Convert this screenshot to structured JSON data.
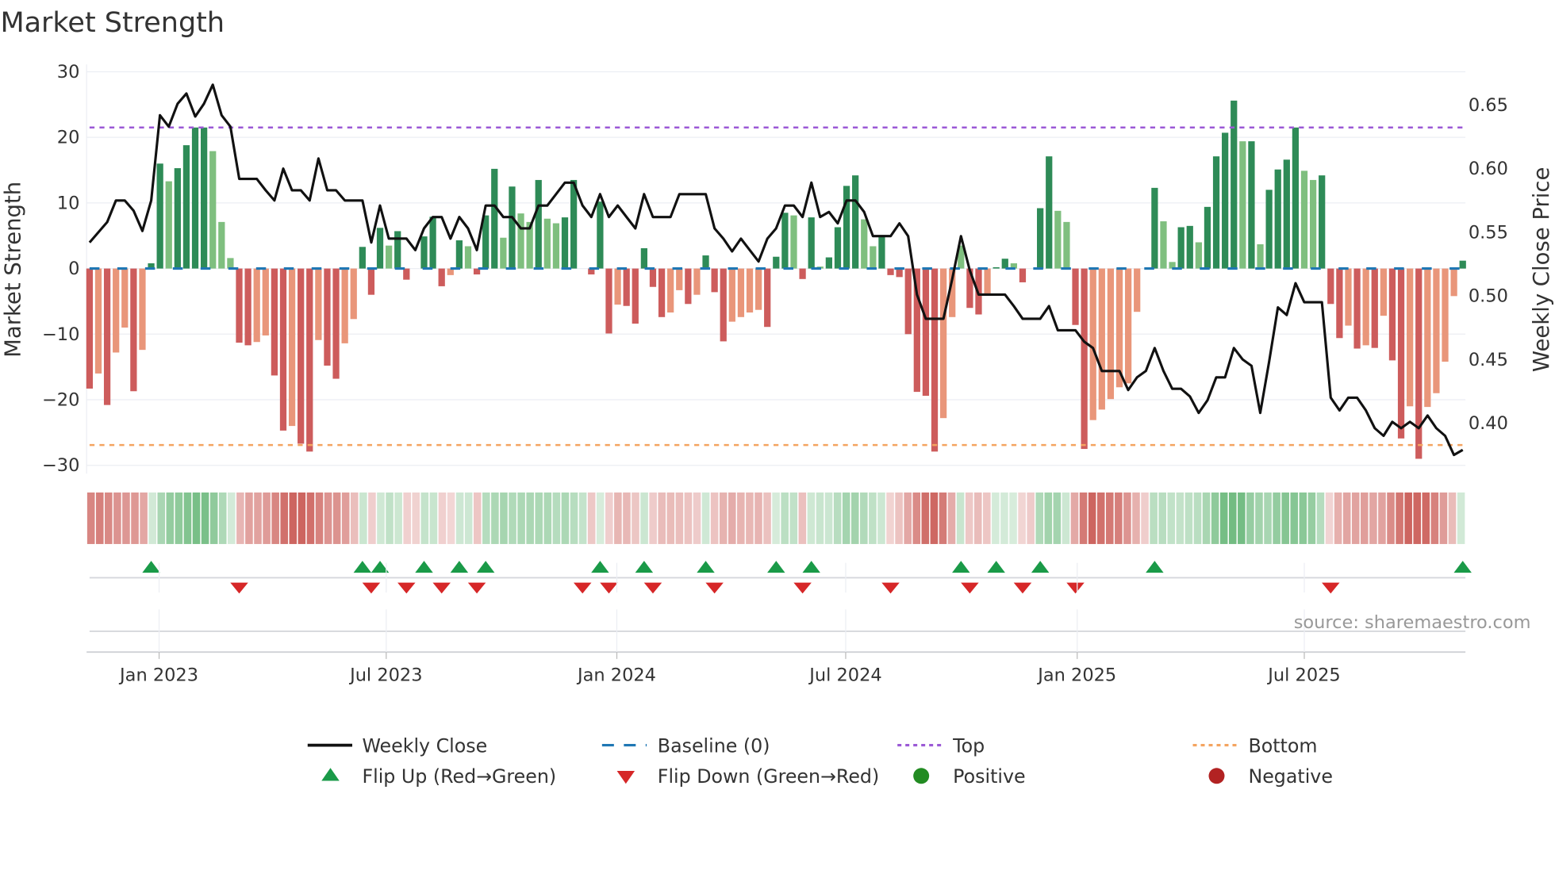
{
  "title": "Market Strength",
  "source": "source: sharemaestro.com",
  "chart_data": {
    "type": "bar",
    "title": "Market Strength",
    "ylabel": "Market Strength",
    "y2label": "Weekly Close Price",
    "ylim": [
      -30,
      30
    ],
    "y2lim": [
      0.37,
      0.665
    ],
    "yticks": [
      "30",
      "20",
      "10",
      "0",
      "−10",
      "−20",
      "−30"
    ],
    "ytick_values": [
      30,
      20,
      10,
      0,
      -10,
      -20,
      -30
    ],
    "y2ticks": [
      "0.65",
      "0.60",
      "0.55",
      "0.50",
      "0.45",
      "0.40"
    ],
    "y2tick_values": [
      0.65,
      0.6,
      0.55,
      0.5,
      0.45,
      0.4
    ],
    "xticks": [
      {
        "label": "Jan 2023",
        "week": 7.9
      },
      {
        "label": "Jul 2023",
        "week": 33.7
      },
      {
        "label": "Jan 2024",
        "week": 59.9
      },
      {
        "label": "Jul 2024",
        "week": 85.9
      },
      {
        "label": "Jan 2025",
        "week": 112.2
      },
      {
        "label": "Jul 2025",
        "week": 138.0
      }
    ],
    "top_level": 21.5,
    "bottom_level": -26.9,
    "baseline": 0,
    "strength": [
      -18.3,
      -16,
      -20.8,
      -12.8,
      -9,
      -18.7,
      -12.4,
      0.8,
      16,
      13.3,
      15.3,
      18.8,
      21.5,
      21.5,
      17.9,
      7.1,
      1.6,
      -11.3,
      -11.7,
      -11.2,
      -10.2,
      -16.3,
      -24.7,
      -24,
      -26.7,
      -27.9,
      -10.9,
      -14.8,
      -16.8,
      -11.4,
      -7.7,
      3.3,
      -4,
      6.2,
      3.5,
      5.7,
      -1.7,
      0,
      4.9,
      7.9,
      -2.7,
      -1,
      4.3,
      3.4,
      -0.9,
      8.1,
      15.2,
      4.7,
      12.5,
      8.4,
      7.1,
      13.5,
      7.6,
      6.9,
      7.8,
      13.5,
      0,
      -0.9,
      10.2,
      -9.9,
      -5.5,
      -5.7,
      -8.4,
      3.1,
      -2.8,
      -7.4,
      -6.7,
      -3.3,
      -5.4,
      -4,
      2,
      -3.6,
      -11.1,
      -8.1,
      -7.4,
      -6.7,
      -6.3,
      -8.9,
      1.8,
      8.5,
      8.1,
      -1.6,
      7.8,
      0.3,
      1.7,
      6.3,
      12.6,
      14.2,
      7.5,
      3.4,
      4.9,
      -1,
      -1.3,
      -10,
      -18.8,
      -19.4,
      -27.9,
      -22.8,
      -7.4,
      3.5,
      -6,
      -7,
      -3.8,
      0.2,
      1.5,
      0.8,
      -2.1,
      0,
      9.2,
      17.1,
      8.8,
      7.1,
      -8.6,
      -27.5,
      -23.1,
      -21.5,
      -19.9,
      -18.1,
      -17.5,
      -6.6,
      0,
      12.3,
      7.2,
      1,
      6.3,
      6.5,
      4,
      9.4,
      17.1,
      20.7,
      25.6,
      19.4,
      19.4,
      3.7,
      12,
      15.1,
      16.6,
      21.5,
      14.9,
      13.5,
      14.2,
      -5.4,
      -10.6,
      -8.7,
      -12.2,
      -11.7,
      -12.1,
      -7.2,
      -14,
      -25.9,
      -21,
      -29,
      -21.1,
      -19,
      -14.2,
      -4.2,
      1.2
    ],
    "strong": [
      1,
      0,
      1,
      0,
      0,
      1,
      0,
      1,
      1,
      0,
      1,
      1,
      1,
      1,
      0,
      0,
      0,
      1,
      1,
      0,
      0,
      1,
      1,
      0,
      1,
      1,
      0,
      1,
      1,
      0,
      0,
      1,
      1,
      1,
      0,
      1,
      1,
      1,
      1,
      1,
      1,
      0,
      1,
      0,
      1,
      1,
      1,
      0,
      1,
      0,
      0,
      1,
      0,
      0,
      1,
      1,
      1,
      1,
      1,
      1,
      0,
      1,
      1,
      1,
      1,
      1,
      0,
      0,
      1,
      0,
      1,
      1,
      1,
      0,
      0,
      0,
      0,
      1,
      1,
      1,
      0,
      1,
      1,
      0,
      1,
      1,
      1,
      1,
      0,
      0,
      1,
      1,
      1,
      1,
      1,
      1,
      1,
      0,
      0,
      0,
      1,
      1,
      0,
      1,
      1,
      0,
      1,
      1,
      1,
      1,
      0,
      0,
      1,
      1,
      0,
      0,
      0,
      0,
      0,
      0,
      1,
      1,
      0,
      0,
      1,
      1,
      0,
      1,
      1,
      1,
      1,
      0,
      1,
      0,
      1,
      1,
      1,
      1,
      0,
      0,
      1,
      1,
      1,
      0,
      1,
      0,
      1,
      0,
      1,
      1,
      0,
      1,
      0,
      0,
      0,
      0,
      1
    ],
    "weekly_close": [
      0.542,
      0.55,
      0.558,
      0.575,
      0.575,
      0.567,
      0.551,
      0.575,
      0.642,
      0.633,
      0.651,
      0.659,
      0.641,
      0.651,
      0.666,
      0.642,
      0.633,
      0.592,
      0.592,
      0.592,
      0.583,
      0.575,
      0.6,
      0.583,
      0.583,
      0.575,
      0.608,
      0.583,
      0.583,
      0.575,
      0.575,
      0.575,
      0.542,
      0.571,
      0.545,
      0.545,
      0.545,
      0.536,
      0.553,
      0.562,
      0.562,
      0.545,
      0.562,
      0.553,
      0.536,
      0.571,
      0.571,
      0.562,
      0.562,
      0.553,
      0.553,
      0.571,
      0.571,
      0.58,
      0.589,
      0.589,
      0.571,
      0.562,
      0.58,
      0.562,
      0.571,
      0.562,
      0.553,
      0.58,
      0.562,
      0.562,
      0.562,
      0.58,
      0.58,
      0.58,
      0.58,
      0.553,
      0.545,
      0.535,
      0.545,
      0.536,
      0.527,
      0.545,
      0.553,
      0.571,
      0.571,
      0.562,
      0.589,
      0.562,
      0.566,
      0.557,
      0.575,
      0.575,
      0.566,
      0.547,
      0.547,
      0.547,
      0.557,
      0.547,
      0.501,
      0.482,
      0.482,
      0.482,
      0.513,
      0.547,
      0.52,
      0.501,
      0.501,
      0.501,
      0.501,
      0.492,
      0.482,
      0.482,
      0.482,
      0.492,
      0.473,
      0.473,
      0.473,
      0.464,
      0.459,
      0.441,
      0.441,
      0.441,
      0.426,
      0.436,
      0.441,
      0.459,
      0.441,
      0.427,
      0.427,
      0.421,
      0.408,
      0.418,
      0.436,
      0.436,
      0.459,
      0.45,
      0.445,
      0.408,
      0.448,
      0.491,
      0.485,
      0.51,
      0.495,
      0.495,
      0.495,
      0.42,
      0.41,
      0.42,
      0.42,
      0.41,
      0.396,
      0.39,
      0.401,
      0.396,
      0.401,
      0.396,
      0.406,
      0.396,
      0.39,
      0.375,
      0.379
    ],
    "flip_up_weeks": [
      7,
      31,
      33,
      38,
      42,
      45,
      58,
      63,
      70,
      78,
      82,
      99,
      103,
      108,
      121,
      156
    ],
    "flip_down_weeks": [
      17,
      32,
      36,
      40,
      44,
      56,
      59,
      64,
      71,
      81,
      91,
      100,
      106,
      112,
      141
    ],
    "colors": {
      "strong_green": "#2e8b57",
      "weak_green": "#7fbf7f",
      "strong_red": "#cd5c5c",
      "weak_red": "#e9967a",
      "close_line": "#111111",
      "baseline": "#1f77b4",
      "top": "#9b59d6",
      "bottom": "#f4a460",
      "flip_up": "#1a9a48",
      "flip_down": "#d62728",
      "positive": "#228b22",
      "negative": "#b22222"
    }
  },
  "legend": {
    "weekly_close": "Weekly Close",
    "baseline": "Baseline (0)",
    "top": "Top",
    "bottom": "Bottom",
    "flip_up": "Flip Up (Red→Green)",
    "flip_down": "Flip Down (Green→Red)",
    "positive": "Positive",
    "negative": "Negative"
  }
}
